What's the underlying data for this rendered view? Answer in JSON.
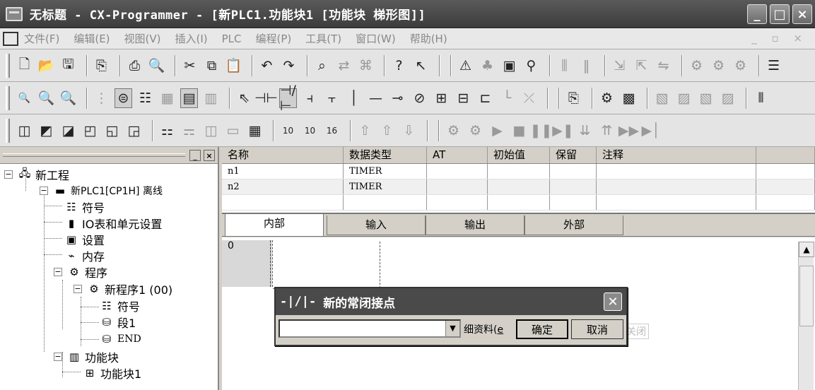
{
  "window": {
    "title": "无标题 - CX-Programmer - [新PLC1.功能块1 [功能块 梯形图]]",
    "controls": [
      "_",
      "□",
      "×"
    ]
  },
  "menu": {
    "items": [
      "文件(F)",
      "编辑(E)",
      "视图(V)",
      "插入(I)",
      "PLC",
      "编程(P)",
      "工具(T)",
      "窗口(W)",
      "帮助(H)"
    ],
    "right_controls": "_ ▫ ×"
  },
  "tree": {
    "header_buttons": [
      "_",
      "×"
    ],
    "nodes": [
      {
        "label": "新工程",
        "icon": "project-icon"
      },
      {
        "label": "新PLC1[CP1H] 离线",
        "icon": "plc-icon"
      },
      {
        "label": "符号",
        "icon": "symbols-icon"
      },
      {
        "label": "IO表和单元设置",
        "icon": "io-table-icon"
      },
      {
        "label": "设置",
        "icon": "settings-icon"
      },
      {
        "label": "内存",
        "icon": "memory-icon"
      },
      {
        "label": "程序",
        "icon": "programs-icon"
      },
      {
        "label": "新程序1 (00)",
        "icon": "program-icon"
      },
      {
        "label": "符号",
        "icon": "symbols-icon"
      },
      {
        "label": "段1",
        "icon": "section-icon"
      },
      {
        "label": "END",
        "icon": "section-icon"
      },
      {
        "label": "功能块",
        "icon": "function-blocks-icon"
      },
      {
        "label": "功能块1",
        "icon": "function-block-icon"
      }
    ]
  },
  "symbols": {
    "columns": [
      "名称",
      "数据类型",
      "AT",
      "初始值",
      "保留",
      "注释",
      ""
    ],
    "rows": [
      [
        "n1",
        "TIMER",
        "",
        "",
        "",
        "",
        ""
      ],
      [
        "n2",
        "TIMER",
        "",
        "",
        "",
        "",
        ""
      ],
      [
        "",
        "",
        "",
        "",
        "",
        "",
        ""
      ]
    ]
  },
  "tabs": [
    "内部",
    "输入",
    "输出",
    "外部"
  ],
  "ladder": {
    "rung_number": "0"
  },
  "dialog": {
    "title_icon": "-|/|-",
    "title": "新的常闭接点",
    "combo_value": "",
    "detail_label": "细资料(",
    "detail_suffix": "e",
    "ok_label": "确定",
    "cancel_label": "取消",
    "ghost_label": "关闭"
  }
}
